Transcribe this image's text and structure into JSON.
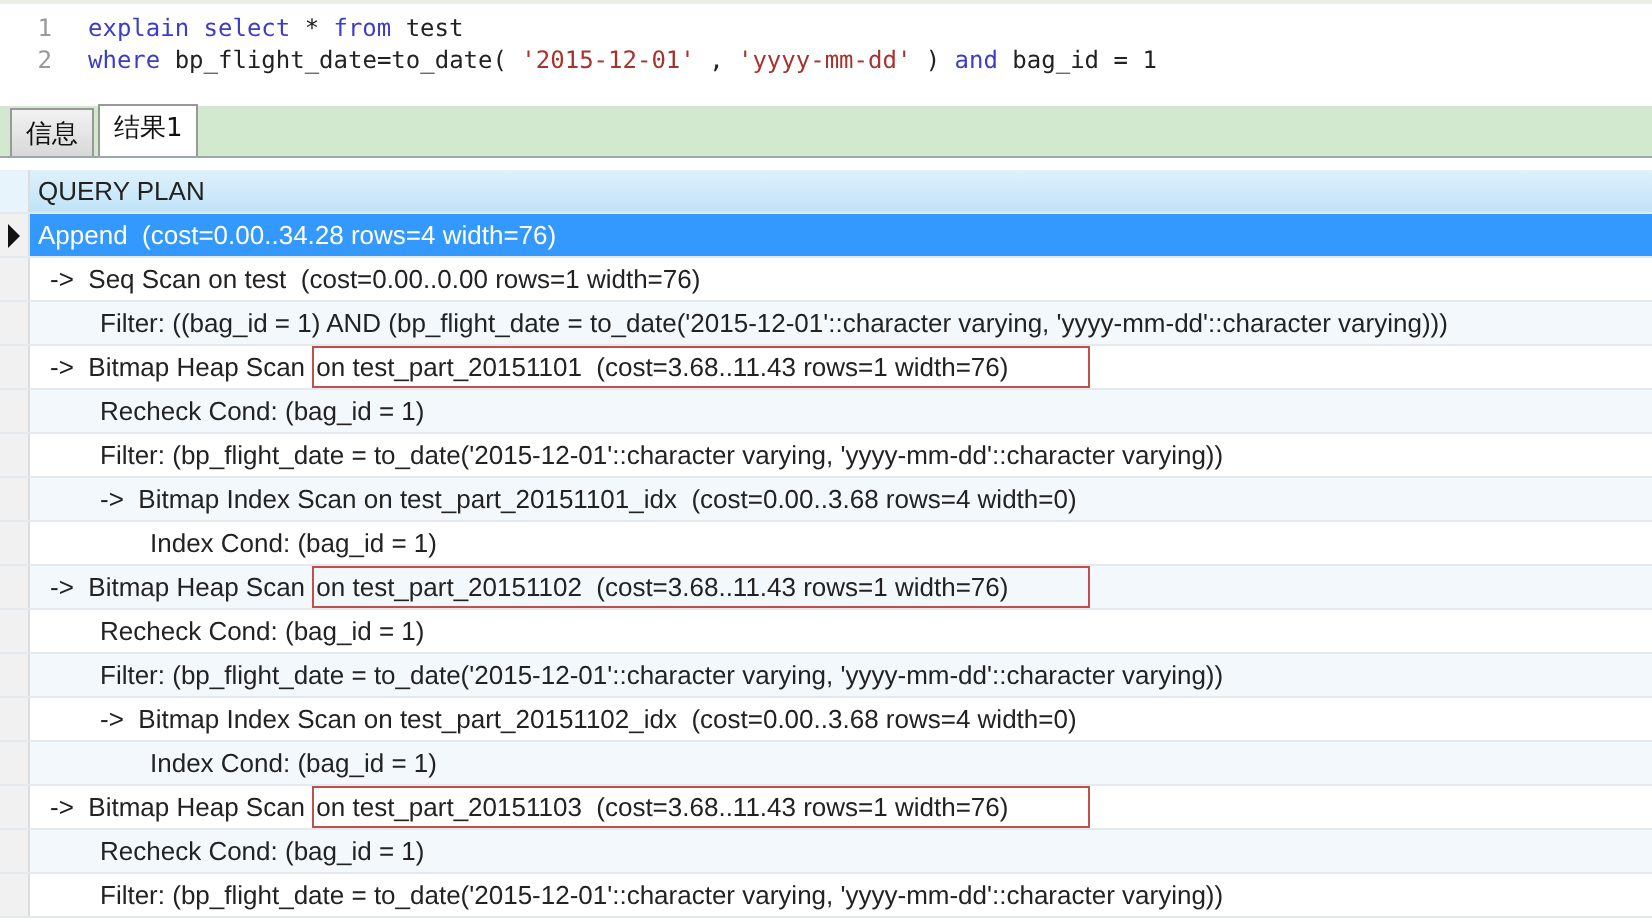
{
  "editor": {
    "lines": [
      {
        "number": "1",
        "tokens": [
          {
            "kind": "keyword",
            "text": "explain"
          },
          {
            "kind": "keyword",
            "text": "select"
          },
          {
            "kind": "plain",
            "text": "*"
          },
          {
            "kind": "keyword",
            "text": "from"
          },
          {
            "kind": "plain",
            "text": "test"
          }
        ]
      },
      {
        "number": "2",
        "tokens": [
          {
            "kind": "keyword",
            "text": "where"
          },
          {
            "kind": "plain",
            "text": "bp_flight_date=to_date("
          },
          {
            "kind": "string",
            "text": "'2015-12-01'"
          },
          {
            "kind": "plain",
            "text": ","
          },
          {
            "kind": "string",
            "text": "'yyyy-mm-dd'"
          },
          {
            "kind": "plain",
            "text": ")"
          },
          {
            "kind": "keyword",
            "text": "and"
          },
          {
            "kind": "plain",
            "text": "bag_id = 1"
          }
        ]
      }
    ]
  },
  "tabs": [
    {
      "label": "信息",
      "selected": false
    },
    {
      "label": "结果1",
      "selected": true
    }
  ],
  "grid": {
    "column": "QUERY PLAN",
    "rows": [
      {
        "text": "Append  (cost=0.00..34.28 rows=4 width=76)",
        "selected": true,
        "children": [
          {
            "text": "->  Seq Scan on test  (cost=0.00..0.00 rows=1 width=76)",
            "selected": false,
            "children": [
              {
                "text": "Filter: ((bag_id = 1) AND (bp_flight_date = to_date('2015-12-01'::character varying, 'yyyy-mm-dd'::character varying)))",
                "selected": false
              }
            ]
          },
          {
            "text": "->  Bitmap Heap Scan ",
            "marked": "on test_part_20151101  (cost=3.68..11.43 rows=1 width=76)",
            "selected": false,
            "children": [
              {
                "text": "Recheck Cond: (bag_id = 1)",
                "selected": false
              },
              {
                "text": "Filter: (bp_flight_date = to_date('2015-12-01'::character varying, 'yyyy-mm-dd'::character varying))",
                "selected": false
              },
              {
                "text": "->  Bitmap Index Scan on test_part_20151101_idx  (cost=0.00..3.68 rows=4 width=0)",
                "selected": false,
                "children": [
                  {
                    "text": "Index Cond: (bag_id = 1)",
                    "selected": false
                  }
                ]
              }
            ]
          },
          {
            "text": "->  Bitmap Heap Scan ",
            "marked": "on test_part_20151102  (cost=3.68..11.43 rows=1 width=76)",
            "selected": false,
            "children": [
              {
                "text": "Recheck Cond: (bag_id = 1)",
                "selected": false
              },
              {
                "text": "Filter: (bp_flight_date = to_date('2015-12-01'::character varying, 'yyyy-mm-dd'::character varying))",
                "selected": false
              },
              {
                "text": "->  Bitmap Index Scan on test_part_20151102_idx  (cost=0.00..3.68 rows=4 width=0)",
                "selected": false,
                "children": [
                  {
                    "text": "Index Cond: (bag_id = 1)",
                    "selected": false
                  }
                ]
              }
            ]
          },
          {
            "text": "->  Bitmap Heap Scan ",
            "marked": "on test_part_20151103  (cost=3.68..11.43 rows=1 width=76)",
            "selected": false,
            "children": [
              {
                "text": "Recheck Cond: (bag_id = 1)",
                "selected": false
              },
              {
                "text": "Filter: (bp_flight_date = to_date('2015-12-01'::character varying, 'yyyy-mm-dd'::character varying))",
                "selected": false
              }
            ]
          }
        ]
      }
    ]
  }
}
